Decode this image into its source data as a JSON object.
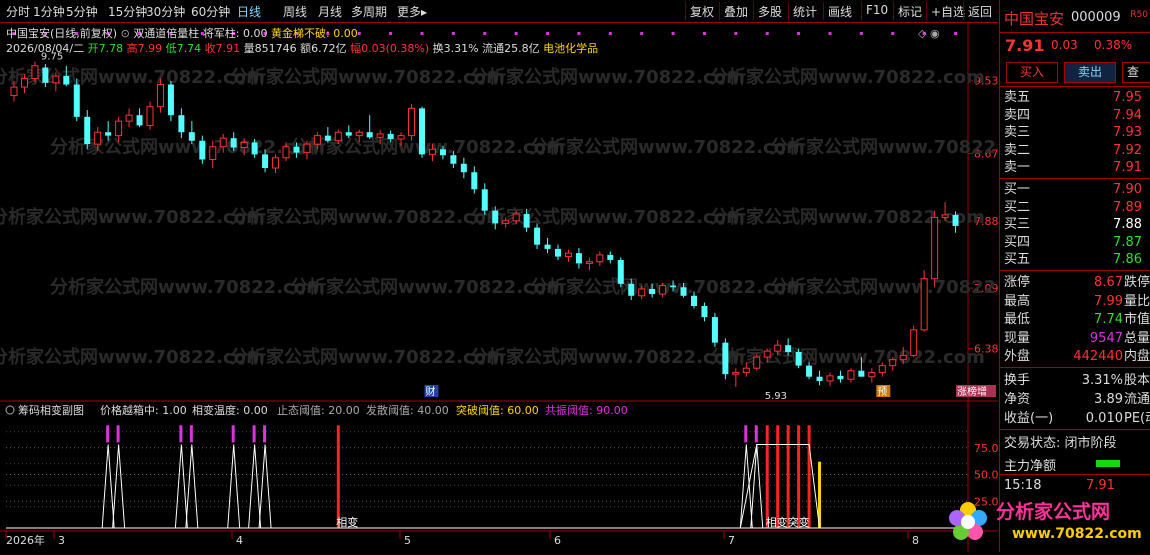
{
  "toolbar": {
    "periods": [
      "分时",
      "1分钟",
      "5分钟",
      "15分钟",
      "30分钟",
      "60分钟",
      "日线",
      "周线",
      "月线",
      "多周期",
      "更多▸"
    ],
    "active_period": "日线",
    "tools": [
      "复权",
      "叠加",
      "多股",
      "统计",
      "画线",
      "F10",
      "标记",
      "+自选",
      "返回"
    ]
  },
  "main_header": {
    "stock": "中国宝安(日线,前复权)",
    "indicator": "双通道倍量柱",
    "jiangjunzhu_label": "将军柱: 0.00",
    "huangjin_label": "黄金梯不破: 0.00",
    "date": "2026/08/04/二",
    "open": "开7.78",
    "high": "高7.99",
    "low": "低7.74",
    "close": "收7.91",
    "volume": "量851746",
    "amount": "额6.72亿",
    "amplitude": "幅0.03(0.38%)",
    "turnover": "换3.31%",
    "float_cap": "流通25.8亿",
    "sector": "电池化学品"
  },
  "price_axis": [
    "9.53",
    "8.67",
    "7.88",
    "7.09",
    "6.38"
  ],
  "annotations": {
    "high_label": "9.75",
    "low_label": "5.93",
    "cai": "财",
    "yu": "预",
    "zhangbang": "涨榜增"
  },
  "sub_header": {
    "name": "筹码相变副图",
    "jiagepr": "价格越箱中: 1.00",
    "wendu": "相变温度: 0.00",
    "zhitai": "止态阈值: 20.00",
    "fasan": "发散阈值: 40.00",
    "tupo": "突破阈值: 60.00",
    "gongzhen": "共振阈值: 90.00"
  },
  "sub_axis": [
    "75.00",
    "50.00",
    "25.00"
  ],
  "sub_labels": {
    "xiangbian1": "相变",
    "xiangbian2": "相变突变"
  },
  "x_axis": [
    "2026年",
    "3",
    "4",
    "5",
    "6",
    "7",
    "8"
  ],
  "side": {
    "name": "中国宝安",
    "code": "000009",
    "badge": "R50",
    "price": "7.91",
    "change": "0.03",
    "pct": "0.38%",
    "buy_btn": "买入",
    "sell_btn": "卖出",
    "more_btn": "查",
    "asks": [
      {
        "label": "卖五",
        "price": "7.95"
      },
      {
        "label": "卖四",
        "price": "7.94"
      },
      {
        "label": "卖三",
        "price": "7.93"
      },
      {
        "label": "卖二",
        "price": "7.92"
      },
      {
        "label": "卖一",
        "price": "7.91"
      }
    ],
    "bids": [
      {
        "label": "买一",
        "price": "7.90",
        "color": "#ff3333"
      },
      {
        "label": "买二",
        "price": "7.89",
        "color": "#ff3333"
      },
      {
        "label": "买三",
        "price": "7.88",
        "color": "#ffffff"
      },
      {
        "label": "买四",
        "price": "7.87",
        "color": "#33dd33"
      },
      {
        "label": "买五",
        "price": "7.86",
        "color": "#33dd33"
      }
    ],
    "stats": [
      {
        "label": "涨停",
        "value": "8.67",
        "color": "#ff3333",
        "label2": "跌停"
      },
      {
        "label": "最高",
        "value": "7.99",
        "color": "#ff3333",
        "label2": "量比"
      },
      {
        "label": "最低",
        "value": "7.74",
        "color": "#33dd33",
        "label2": "市值"
      },
      {
        "label": "现量",
        "value": "9547",
        "color": "#dd33dd",
        "label2": "总量"
      },
      {
        "label": "外盘",
        "value": "442440",
        "color": "#ff3333",
        "label2": "内盘"
      }
    ],
    "stats2": [
      {
        "label": "换手",
        "value": "3.31%",
        "color": "#dddddd",
        "label2": "股本"
      },
      {
        "label": "净资",
        "value": "3.89",
        "color": "#dddddd",
        "label2": "流通"
      },
      {
        "label": "收益(一)",
        "value": "0.010",
        "color": "#dddddd",
        "label2": "PE(动"
      }
    ],
    "status": "交易状态: 闭市阶段",
    "netflow_label": "主力净额",
    "time": "15:18",
    "last_price": "7.91"
  },
  "watermark": {
    "site": "分析家公式网",
    "url": "www.70822.com"
  },
  "candles": [
    {
      "o": 9.35,
      "h": 9.52,
      "l": 9.28,
      "c": 9.45
    },
    {
      "o": 9.45,
      "h": 9.6,
      "l": 9.38,
      "c": 9.55
    },
    {
      "o": 9.55,
      "h": 9.75,
      "l": 9.5,
      "c": 9.7
    },
    {
      "o": 9.68,
      "h": 9.72,
      "l": 9.45,
      "c": 9.5
    },
    {
      "o": 9.5,
      "h": 9.62,
      "l": 9.4,
      "c": 9.58
    },
    {
      "o": 9.58,
      "h": 9.7,
      "l": 9.46,
      "c": 9.48
    },
    {
      "o": 9.48,
      "h": 9.55,
      "l": 9.05,
      "c": 9.1
    },
    {
      "o": 9.1,
      "h": 9.18,
      "l": 8.72,
      "c": 8.78
    },
    {
      "o": 8.78,
      "h": 8.98,
      "l": 8.7,
      "c": 8.92
    },
    {
      "o": 8.92,
      "h": 9.05,
      "l": 8.82,
      "c": 8.88
    },
    {
      "o": 8.88,
      "h": 9.1,
      "l": 8.8,
      "c": 9.05
    },
    {
      "o": 9.05,
      "h": 9.2,
      "l": 8.98,
      "c": 9.12
    },
    {
      "o": 9.12,
      "h": 9.2,
      "l": 8.98,
      "c": 9.0
    },
    {
      "o": 9.0,
      "h": 9.28,
      "l": 8.95,
      "c": 9.22
    },
    {
      "o": 9.22,
      "h": 9.55,
      "l": 9.15,
      "c": 9.48
    },
    {
      "o": 9.48,
      "h": 9.52,
      "l": 9.05,
      "c": 9.12
    },
    {
      "o": 9.12,
      "h": 9.2,
      "l": 8.85,
      "c": 8.92
    },
    {
      "o": 8.92,
      "h": 9.05,
      "l": 8.78,
      "c": 8.82
    },
    {
      "o": 8.82,
      "h": 8.88,
      "l": 8.55,
      "c": 8.6
    },
    {
      "o": 8.6,
      "h": 8.82,
      "l": 8.5,
      "c": 8.75
    },
    {
      "o": 8.75,
      "h": 8.9,
      "l": 8.68,
      "c": 8.85
    },
    {
      "o": 8.85,
      "h": 8.92,
      "l": 8.7,
      "c": 8.74
    },
    {
      "o": 8.74,
      "h": 8.85,
      "l": 8.65,
      "c": 8.8
    },
    {
      "o": 8.8,
      "h": 8.84,
      "l": 8.62,
      "c": 8.66
    },
    {
      "o": 8.66,
      "h": 8.72,
      "l": 8.45,
      "c": 8.5
    },
    {
      "o": 8.5,
      "h": 8.66,
      "l": 8.44,
      "c": 8.62
    },
    {
      "o": 8.62,
      "h": 8.8,
      "l": 8.58,
      "c": 8.75
    },
    {
      "o": 8.75,
      "h": 8.8,
      "l": 8.62,
      "c": 8.68
    },
    {
      "o": 8.68,
      "h": 8.82,
      "l": 8.6,
      "c": 8.78
    },
    {
      "o": 8.78,
      "h": 8.92,
      "l": 8.72,
      "c": 8.88
    },
    {
      "o": 8.88,
      "h": 8.98,
      "l": 8.8,
      "c": 8.82
    },
    {
      "o": 8.82,
      "h": 8.95,
      "l": 8.78,
      "c": 8.92
    },
    {
      "o": 8.92,
      "h": 9.0,
      "l": 8.85,
      "c": 8.88
    },
    {
      "o": 8.88,
      "h": 8.95,
      "l": 8.8,
      "c": 8.92
    },
    {
      "o": 8.92,
      "h": 9.12,
      "l": 8.84,
      "c": 8.86
    },
    {
      "o": 8.86,
      "h": 8.95,
      "l": 8.78,
      "c": 8.9
    },
    {
      "o": 8.9,
      "h": 8.94,
      "l": 8.8,
      "c": 8.84
    },
    {
      "o": 8.84,
      "h": 8.92,
      "l": 8.76,
      "c": 8.88
    },
    {
      "o": 8.88,
      "h": 9.25,
      "l": 8.82,
      "c": 9.2
    },
    {
      "o": 9.2,
      "h": 9.22,
      "l": 8.62,
      "c": 8.66
    },
    {
      "o": 8.66,
      "h": 8.78,
      "l": 8.58,
      "c": 8.72
    },
    {
      "o": 8.72,
      "h": 8.76,
      "l": 8.6,
      "c": 8.65
    },
    {
      "o": 8.65,
      "h": 8.7,
      "l": 8.5,
      "c": 8.55
    },
    {
      "o": 8.55,
      "h": 8.62,
      "l": 8.38,
      "c": 8.45
    },
    {
      "o": 8.45,
      "h": 8.52,
      "l": 8.2,
      "c": 8.25
    },
    {
      "o": 8.25,
      "h": 8.32,
      "l": 7.95,
      "c": 8.0
    },
    {
      "o": 8.0,
      "h": 8.05,
      "l": 7.78,
      "c": 7.85
    },
    {
      "o": 7.85,
      "h": 7.92,
      "l": 7.8,
      "c": 7.88
    },
    {
      "o": 7.88,
      "h": 8.0,
      "l": 7.84,
      "c": 7.96
    },
    {
      "o": 7.96,
      "h": 8.02,
      "l": 7.75,
      "c": 7.8
    },
    {
      "o": 7.8,
      "h": 7.85,
      "l": 7.55,
      "c": 7.6
    },
    {
      "o": 7.6,
      "h": 7.68,
      "l": 7.5,
      "c": 7.55
    },
    {
      "o": 7.55,
      "h": 7.6,
      "l": 7.42,
      "c": 7.46
    },
    {
      "o": 7.46,
      "h": 7.54,
      "l": 7.4,
      "c": 7.5
    },
    {
      "o": 7.5,
      "h": 7.56,
      "l": 7.32,
      "c": 7.38
    },
    {
      "o": 7.38,
      "h": 7.45,
      "l": 7.3,
      "c": 7.4
    },
    {
      "o": 7.4,
      "h": 7.52,
      "l": 7.35,
      "c": 7.48
    },
    {
      "o": 7.48,
      "h": 7.52,
      "l": 7.38,
      "c": 7.42
    },
    {
      "o": 7.42,
      "h": 7.45,
      "l": 7.1,
      "c": 7.14
    },
    {
      "o": 7.14,
      "h": 7.2,
      "l": 6.95,
      "c": 7.0
    },
    {
      "o": 7.0,
      "h": 7.12,
      "l": 6.96,
      "c": 7.08
    },
    {
      "o": 7.08,
      "h": 7.14,
      "l": 6.98,
      "c": 7.02
    },
    {
      "o": 7.02,
      "h": 7.15,
      "l": 6.98,
      "c": 7.12
    },
    {
      "o": 7.12,
      "h": 7.18,
      "l": 7.05,
      "c": 7.1
    },
    {
      "o": 7.1,
      "h": 7.15,
      "l": 6.98,
      "c": 7.0
    },
    {
      "o": 7.0,
      "h": 7.05,
      "l": 6.85,
      "c": 6.88
    },
    {
      "o": 6.88,
      "h": 6.92,
      "l": 6.7,
      "c": 6.75
    },
    {
      "o": 6.75,
      "h": 6.8,
      "l": 6.4,
      "c": 6.45
    },
    {
      "o": 6.45,
      "h": 6.5,
      "l": 6.02,
      "c": 6.08
    },
    {
      "o": 6.08,
      "h": 6.15,
      "l": 5.93,
      "c": 6.1
    },
    {
      "o": 6.1,
      "h": 6.22,
      "l": 6.05,
      "c": 6.15
    },
    {
      "o": 6.15,
      "h": 6.32,
      "l": 6.12,
      "c": 6.28
    },
    {
      "o": 6.28,
      "h": 6.38,
      "l": 6.22,
      "c": 6.35
    },
    {
      "o": 6.35,
      "h": 6.48,
      "l": 6.3,
      "c": 6.42
    },
    {
      "o": 6.42,
      "h": 6.5,
      "l": 6.3,
      "c": 6.34
    },
    {
      "o": 6.34,
      "h": 6.38,
      "l": 6.15,
      "c": 6.18
    },
    {
      "o": 6.18,
      "h": 6.22,
      "l": 6.02,
      "c": 6.05
    },
    {
      "o": 6.05,
      "h": 6.12,
      "l": 5.95,
      "c": 6.0
    },
    {
      "o": 6.0,
      "h": 6.1,
      "l": 5.94,
      "c": 6.06
    },
    {
      "o": 6.06,
      "h": 6.12,
      "l": 5.98,
      "c": 6.02
    },
    {
      "o": 6.02,
      "h": 6.15,
      "l": 5.98,
      "c": 6.12
    },
    {
      "o": 6.12,
      "h": 6.28,
      "l": 6.08,
      "c": 6.05
    },
    {
      "o": 6.05,
      "h": 6.15,
      "l": 5.98,
      "c": 6.1
    },
    {
      "o": 6.1,
      "h": 6.22,
      "l": 6.05,
      "c": 6.18
    },
    {
      "o": 6.18,
      "h": 6.28,
      "l": 6.12,
      "c": 6.25
    },
    {
      "o": 6.25,
      "h": 6.4,
      "l": 6.2,
      "c": 6.3
    },
    {
      "o": 6.3,
      "h": 6.65,
      "l": 6.28,
      "c": 6.6
    },
    {
      "o": 6.6,
      "h": 7.3,
      "l": 6.58,
      "c": 7.2
    },
    {
      "o": 7.2,
      "h": 8.0,
      "l": 7.1,
      "c": 7.92
    },
    {
      "o": 7.92,
      "h": 8.1,
      "l": 7.88,
      "c": 7.95
    },
    {
      "o": 7.95,
      "h": 7.99,
      "l": 7.74,
      "c": 7.82
    }
  ],
  "sub_signals": [
    {
      "i": 9,
      "kind": "white"
    },
    {
      "i": 10,
      "kind": "white"
    },
    {
      "i": 16,
      "kind": "white"
    },
    {
      "i": 17,
      "kind": "white"
    },
    {
      "i": 21,
      "kind": "white"
    },
    {
      "i": 23,
      "kind": "white"
    },
    {
      "i": 24,
      "kind": "white"
    },
    {
      "i": 31,
      "kind": "red"
    },
    {
      "i": 70,
      "kind": "white"
    },
    {
      "i": 71,
      "kind": "white"
    },
    {
      "i": 72,
      "kind": "red"
    },
    {
      "i": 73,
      "kind": "red"
    },
    {
      "i": 74,
      "kind": "red"
    },
    {
      "i": 75,
      "kind": "red"
    },
    {
      "i": 76,
      "kind": "red"
    },
    {
      "i": 77,
      "kind": "yellow"
    }
  ]
}
